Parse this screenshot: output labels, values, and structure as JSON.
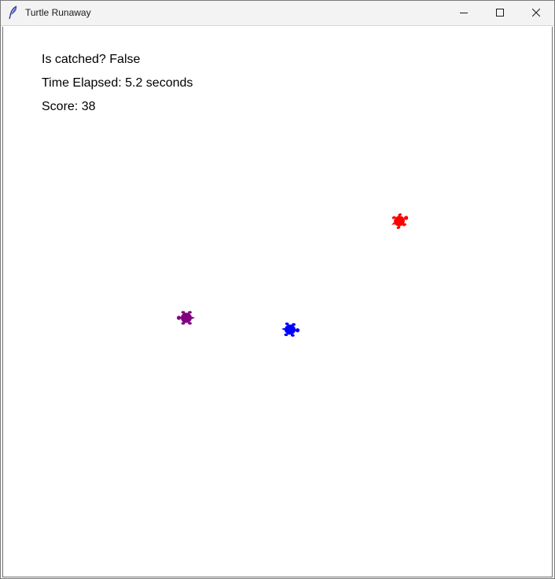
{
  "window": {
    "title": "Turtle Runaway",
    "icon": "feather-icon"
  },
  "hud": {
    "caught_label": "Is catched? False",
    "time_label": "Time Elapsed: 5.2 seconds",
    "score_label": "Score: 38"
  },
  "turtles": [
    {
      "name": "red-turtle",
      "color": "#ff0000"
    },
    {
      "name": "purple-turtle",
      "color": "#800080"
    },
    {
      "name": "blue-turtle",
      "color": "#0000ff"
    }
  ],
  "colors": {
    "titlebar": "#f3f3f3",
    "canvas": "#ffffff",
    "text": "#000000"
  }
}
